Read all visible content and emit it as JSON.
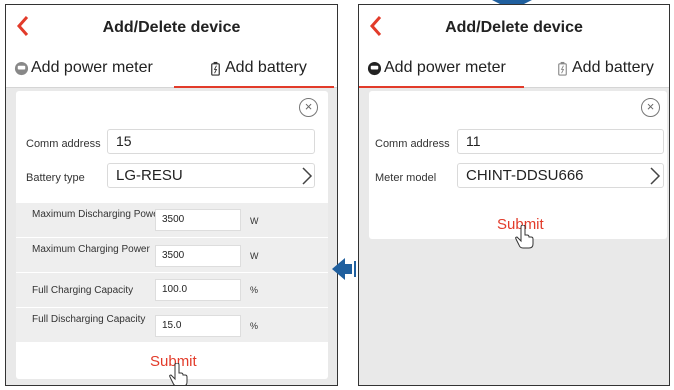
{
  "left": {
    "title": "Add/Delete device",
    "tabs": [
      {
        "label": "Add power meter",
        "icon": "power-meter-icon"
      },
      {
        "label": "Add battery",
        "icon": "battery-icon"
      }
    ],
    "comm_address": {
      "label": "Comm address",
      "value": "15"
    },
    "battery_type": {
      "label": "Battery type",
      "value": "LG-RESU"
    },
    "params": [
      {
        "label": "Maximum Discharging Power",
        "value": "3500",
        "unit": "W"
      },
      {
        "label": "Maximum Charging Power",
        "value": "3500",
        "unit": "W"
      },
      {
        "label": "Full Charging Capacity",
        "value": "100.0",
        "unit": "%"
      },
      {
        "label": "Full Discharging Capacity",
        "value": "15.0",
        "unit": "%"
      }
    ],
    "submit_label": "Submit"
  },
  "right": {
    "title": "Add/Delete device",
    "tabs": [
      {
        "label": "Add power meter",
        "icon": "power-meter-icon"
      },
      {
        "label": "Add battery",
        "icon": "battery-icon"
      }
    ],
    "comm_address": {
      "label": "Comm address",
      "value": "11"
    },
    "meter_model": {
      "label": "Meter model",
      "value": "CHINT-DDSU666"
    },
    "submit_label": "Submit"
  },
  "colors": {
    "accent": "#e23b2a",
    "background": "#e9e9e9",
    "arrow": "#1f5f9e"
  }
}
